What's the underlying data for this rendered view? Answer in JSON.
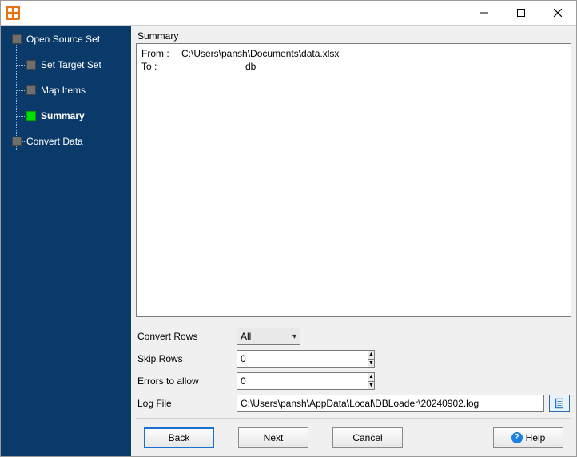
{
  "window": {
    "title": ""
  },
  "sidebar": {
    "items": [
      {
        "label": "Open Source Set"
      },
      {
        "label": "Set Target Set"
      },
      {
        "label": "Map Items"
      },
      {
        "label": "Summary"
      },
      {
        "label": "Convert Data"
      }
    ],
    "current_index": 3
  },
  "summary": {
    "heading": "Summary",
    "from_label": "From :",
    "from_value": "C:\\Users\\pansh\\Documents\\data.xlsx",
    "to_label": "To :",
    "to_value": "db"
  },
  "options": {
    "convert_rows": {
      "label": "Convert Rows",
      "value": "All"
    },
    "skip_rows": {
      "label": "Skip Rows",
      "value": "0"
    },
    "errors": {
      "label": "Errors to allow",
      "value": "0"
    },
    "log_file": {
      "label": "Log File",
      "value": "C:\\Users\\pansh\\AppData\\Local\\DBLoader\\20240902.log"
    }
  },
  "buttons": {
    "back": "Back",
    "next": "Next",
    "cancel": "Cancel",
    "help": "Help"
  }
}
